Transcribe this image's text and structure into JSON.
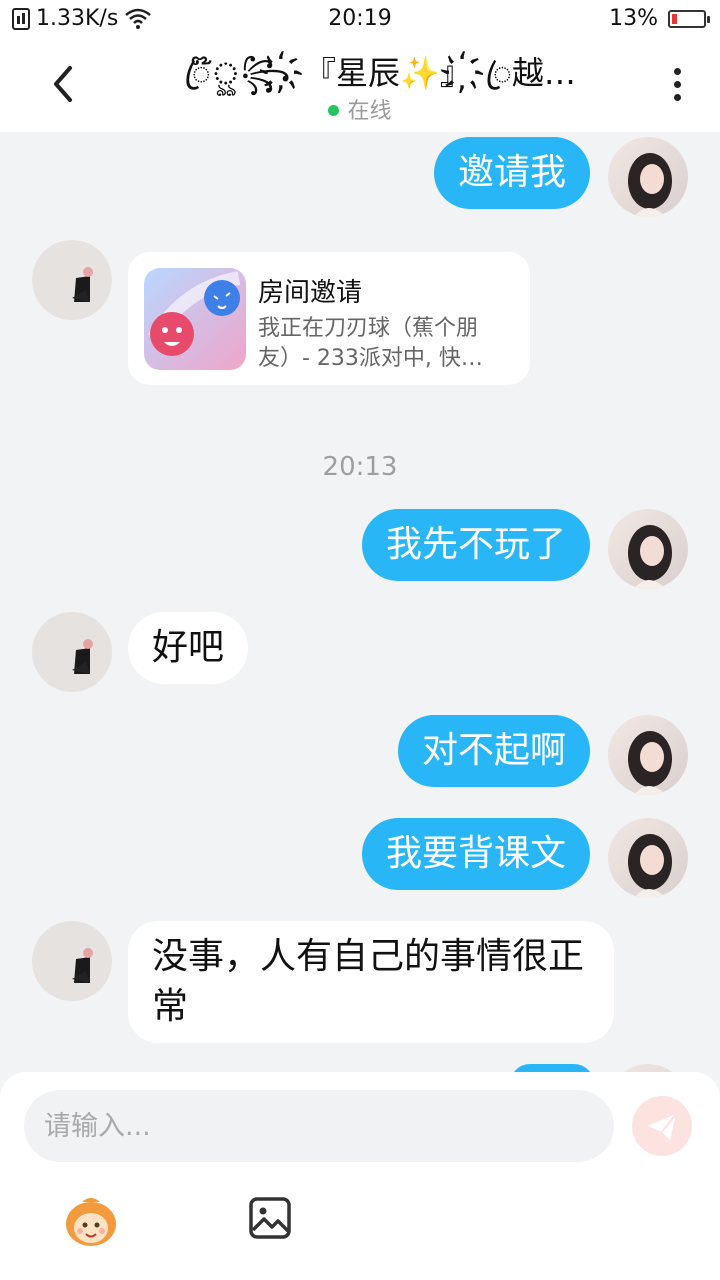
{
  "status_bar": {
    "speed": "1.33K/s",
    "time": "20:19",
    "battery": "13%"
  },
  "header": {
    "title": "ꦿ໊ৣ꧂҉『星辰✨』҉ꦿ越…",
    "status": "在线"
  },
  "messages": [
    {
      "from": "me",
      "text": "邀请我"
    },
    {
      "from": "other",
      "type": "card",
      "title": "房间邀请",
      "desc": "我正在刀刃球（蕉个朋友）- 233派对中, 快…"
    },
    {
      "type": "time",
      "text": "20:13"
    },
    {
      "from": "me",
      "text": "我先不玩了"
    },
    {
      "from": "other",
      "text": "好吧"
    },
    {
      "from": "me",
      "text": "对不起啊"
    },
    {
      "from": "me",
      "text": "我要背课文"
    },
    {
      "from": "other",
      "text": "没事，人有自己的事情很正常"
    }
  ],
  "input": {
    "placeholder": "请输入..."
  },
  "colors": {
    "accent": "#29b6f6",
    "online": "#22c55e",
    "battery_low": "#e53935"
  }
}
